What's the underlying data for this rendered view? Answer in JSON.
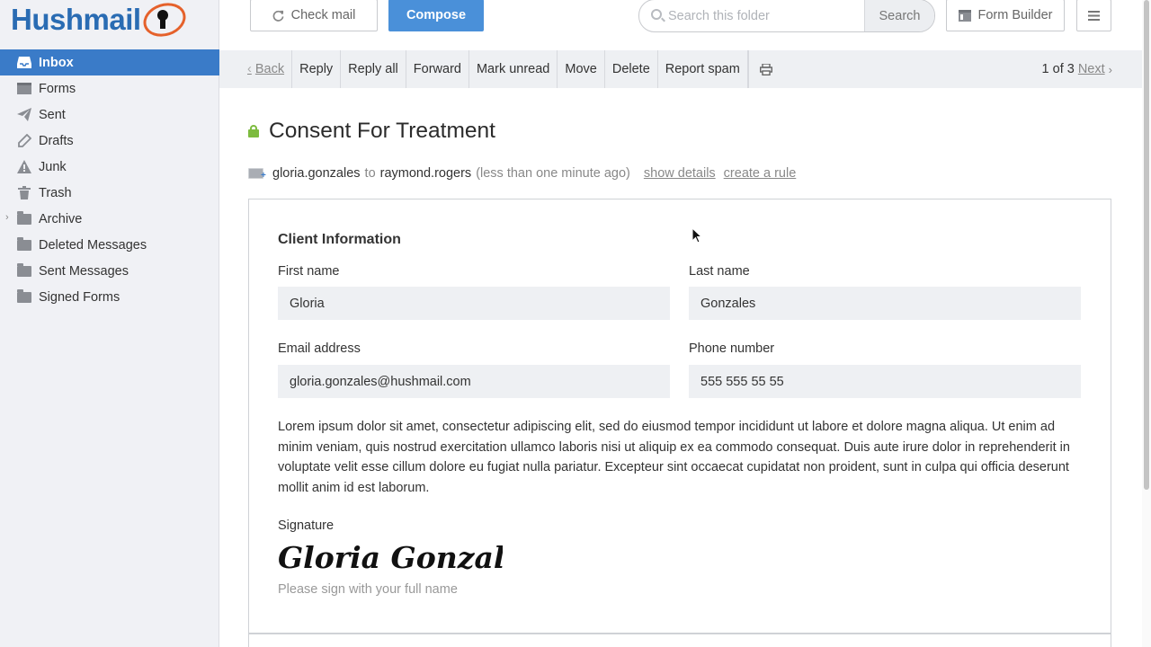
{
  "brand": {
    "name_part1": "Hush",
    "name_part2": "mail",
    "accent_color": "#3a7bc8",
    "logo_ring_color": "#e5612b"
  },
  "sidebar": {
    "items": [
      {
        "label": "Inbox",
        "icon": "inbox-icon",
        "active": true
      },
      {
        "label": "Forms",
        "icon": "forms-icon"
      },
      {
        "label": "Sent",
        "icon": "paper-plane-icon"
      },
      {
        "label": "Drafts",
        "icon": "pencil-icon"
      },
      {
        "label": "Junk",
        "icon": "warning-icon"
      },
      {
        "label": "Trash",
        "icon": "trash-icon"
      },
      {
        "label": "Archive",
        "icon": "folder-icon",
        "expandable": true
      },
      {
        "label": "Deleted Messages",
        "icon": "folder-icon"
      },
      {
        "label": "Sent Messages",
        "icon": "folder-icon"
      },
      {
        "label": "Signed Forms",
        "icon": "folder-icon"
      }
    ]
  },
  "topbar": {
    "check_mail_label": "Check mail",
    "compose_label": "Compose",
    "search_placeholder": "Search this folder",
    "search_button_label": "Search",
    "form_builder_label": "Form Builder"
  },
  "message_toolbar": {
    "back_label": "Back",
    "actions": [
      "Reply",
      "Reply all",
      "Forward",
      "Mark unread",
      "Move",
      "Delete",
      "Report spam"
    ],
    "pager_text": "1 of 3",
    "next_label": "Next"
  },
  "message": {
    "subject": "Consent For Treatment",
    "from": "gloria.gonzales",
    "to_word": "to",
    "to": "raymond.rogers",
    "time": "(less than one minute ago)",
    "show_details_label": "show details",
    "create_rule_label": "create a rule"
  },
  "form": {
    "section_title": "Client Information",
    "first_name_label": "First name",
    "first_name_value": "Gloria",
    "last_name_label": "Last name",
    "last_name_value": "Gonzales",
    "email_label": "Email address",
    "email_value": "gloria.gonzales@hushmail.com",
    "phone_label": "Phone number",
    "phone_value": "555 555 55 55",
    "body_text": "Lorem ipsum dolor sit amet, consectetur adipiscing elit, sed do eiusmod tempor incididunt ut labore et dolore magna aliqua. Ut enim ad minim veniam, quis nostrud exercitation ullamco laboris nisi ut aliquip ex ea commodo consequat. Duis aute irure dolor in reprehenderit in voluptate velit esse cillum dolore eu fugiat nulla pariatur. Excepteur sint occaecat cupidatat non proident, sunt in culpa qui officia deserunt mollit anim id est laborum.",
    "signature_label": "Signature",
    "signature_name": "Gloria Gonzales",
    "signature_hint": "Please sign with your full name"
  }
}
